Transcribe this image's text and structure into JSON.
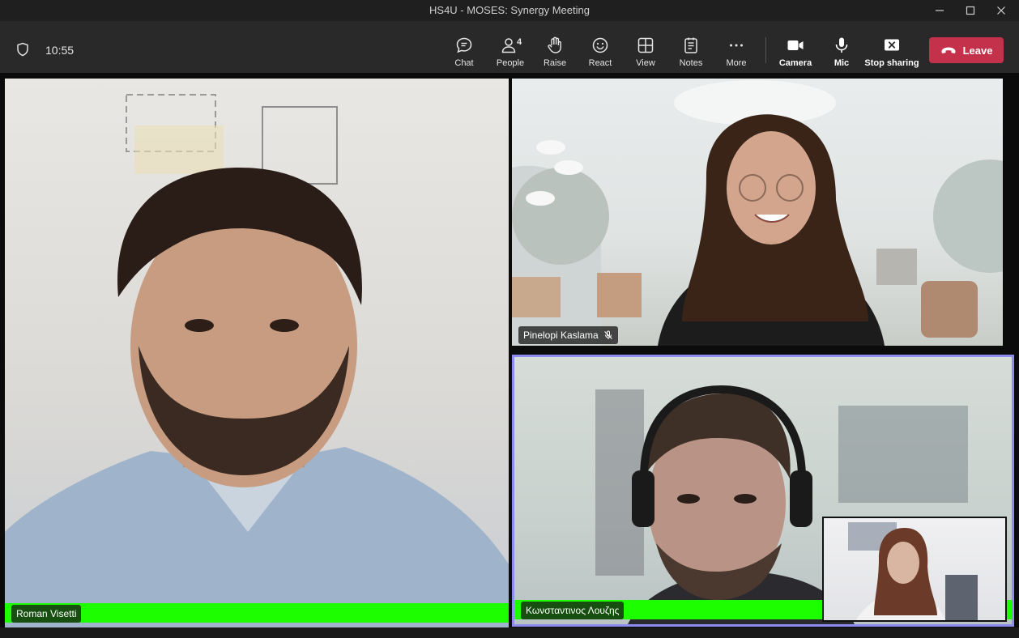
{
  "window": {
    "title": "HS4U - MOSES: Synergy Meeting"
  },
  "toolbar": {
    "time": "10:55",
    "people_count": "4",
    "buttons": {
      "chat": "Chat",
      "people": "People",
      "raise": "Raise",
      "react": "React",
      "view": "View",
      "notes": "Notes",
      "more": "More",
      "camera": "Camera",
      "mic": "Mic",
      "stop_sharing": "Stop sharing",
      "leave": "Leave"
    }
  },
  "participants": [
    {
      "name": "Roman Visetti",
      "muted": false
    },
    {
      "name": "Pinelopi Kaslama",
      "muted": true
    },
    {
      "name": "Κωνσταντινος Λουζης",
      "muted": false
    }
  ],
  "colors": {
    "title_bar": "#1f1f1f",
    "toolbar": "#292929",
    "leave_button": "#c4314b",
    "active_speaker_border": "#8f8cf0",
    "green_overlay": "#1dff00"
  }
}
